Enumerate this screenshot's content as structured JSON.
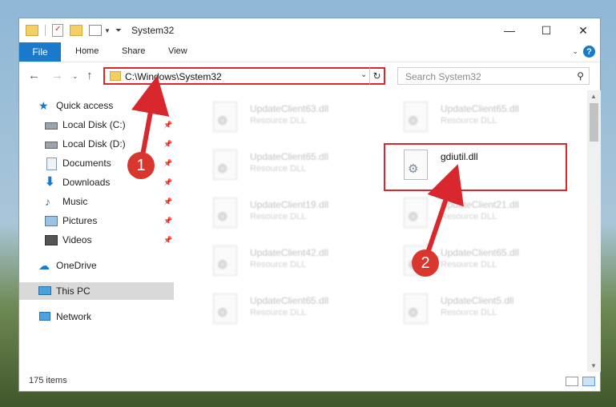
{
  "window": {
    "title": "System32",
    "minimize_icon": "minimize-icon",
    "maximize_icon": "maximize-icon",
    "close_icon": "close-icon",
    "minimize_glyph": "—",
    "maximize_glyph": "☐",
    "close_glyph": "✕"
  },
  "ribbon": {
    "file": "File",
    "tabs": [
      "Home",
      "Share",
      "View"
    ]
  },
  "address": {
    "path": "C:\\Windows\\System32",
    "search_placeholder": "Search System32"
  },
  "nav": {
    "quick_access": "Quick access",
    "items": [
      {
        "label": "Local Disk (C:)",
        "icon": "drive-icon",
        "pinned": true
      },
      {
        "label": "Local Disk (D:)",
        "icon": "drive-icon",
        "pinned": true
      },
      {
        "label": "Documents",
        "icon": "documents-icon",
        "pinned": true
      },
      {
        "label": "Downloads",
        "icon": "downloads-icon",
        "pinned": true
      },
      {
        "label": "Music",
        "icon": "music-icon",
        "pinned": true
      },
      {
        "label": "Pictures",
        "icon": "pictures-icon",
        "pinned": true
      },
      {
        "label": "Videos",
        "icon": "videos-icon",
        "pinned": true
      }
    ],
    "onedrive": "OneDrive",
    "this_pc": "This PC",
    "network": "Network"
  },
  "files": [
    {
      "name": "UpdateClient63.dll",
      "type": "Resource DLL",
      "highlighted": false
    },
    {
      "name": "UpdateClient65.dll",
      "type": "Resource DLL",
      "highlighted": false
    },
    {
      "name": "UpdateClient65.dll",
      "type": "Resource DLL",
      "highlighted": false
    },
    {
      "name": "gdiutil.dll",
      "type": "",
      "highlighted": true
    },
    {
      "name": "UpdateClient19.dll",
      "type": "Resource DLL",
      "highlighted": false
    },
    {
      "name": "UpdateClient21.dll",
      "type": "Resource DLL",
      "highlighted": false
    },
    {
      "name": "UpdateClient42.dll",
      "type": "Resource DLL",
      "highlighted": false
    },
    {
      "name": "UpdateClient65.dll",
      "type": "Resource DLL",
      "highlighted": false
    },
    {
      "name": "UpdateClient65.dll",
      "type": "Resource DLL",
      "highlighted": false
    },
    {
      "name": "UpdateClient5.dll",
      "type": "Resource DLL",
      "highlighted": false
    }
  ],
  "status": {
    "item_count": "175 items"
  },
  "annotations": {
    "step1": "1",
    "step2": "2",
    "color": "#d9272e"
  }
}
